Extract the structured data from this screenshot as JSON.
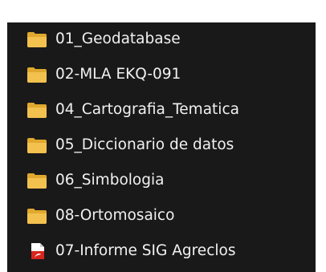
{
  "file_list": {
    "items": [
      {
        "label": "01_Geodatabase",
        "icon": "folder-icon"
      },
      {
        "label": "02-MLA EKQ-091",
        "icon": "folder-icon"
      },
      {
        "label": "04_Cartografia_Tematica",
        "icon": "folder-icon"
      },
      {
        "label": "05_Diccionario de datos",
        "icon": "folder-icon"
      },
      {
        "label": "06_Simbologia",
        "icon": "folder-icon"
      },
      {
        "label": "08-Ortomosaico",
        "icon": "folder-icon"
      },
      {
        "label": "07-Informe SIG Agreclos",
        "icon": "pdf-file-icon"
      }
    ]
  },
  "colors": {
    "background": "#191919",
    "text": "#f1f1f1",
    "folder": "#f2c14e",
    "folder_back": "#e0a82e",
    "pdf_accent": "#d9251d"
  }
}
